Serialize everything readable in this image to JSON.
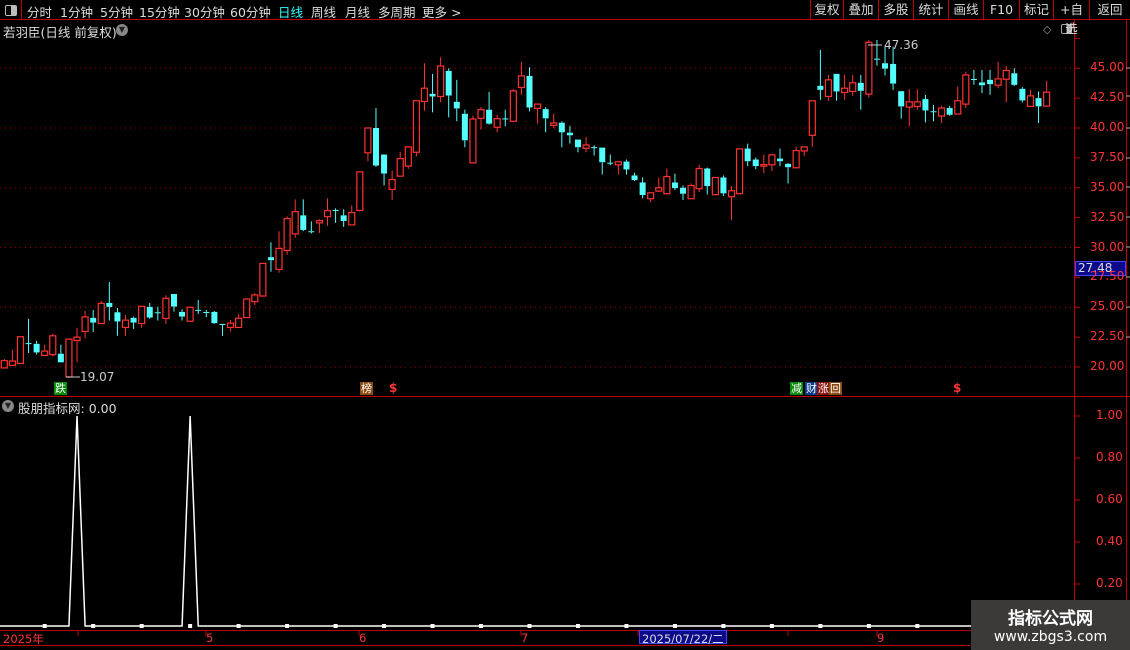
{
  "toolbar": {
    "periods": [
      "分时",
      "1分钟",
      "5分钟",
      "15分钟",
      "30分钟",
      "60分钟",
      "日线",
      "周线",
      "月线",
      "多周期",
      "更多 >"
    ],
    "active": "日线",
    "right_buttons": [
      "复权",
      "叠加",
      "多股",
      "统计",
      "画线",
      "F10",
      "标记",
      "+自选",
      "返回"
    ]
  },
  "chart_title": "若羽臣(日线 前复权)",
  "price_axis": {
    "labels": [
      "45.00",
      "42.50",
      "40.00",
      "37.50",
      "35.00",
      "32.50",
      "30.00",
      "27.50",
      "25.00",
      "22.50",
      "20.00"
    ],
    "current_price": "27.48"
  },
  "annotations": {
    "low": "19.07",
    "high": "47.36"
  },
  "signals": [
    {
      "text": "跌",
      "color": "#0a8a0a"
    },
    {
      "text": "榜",
      "color": "#8a4a10"
    },
    {
      "text": "$",
      "color": "#ff3333"
    },
    {
      "text": "减",
      "color": "#0a8a0a"
    },
    {
      "text": "财",
      "color": "#0a3a8a"
    },
    {
      "text": "涨",
      "color": "#8a1010"
    },
    {
      "text": "回",
      "color": "#8a4a10"
    },
    {
      "text": "$",
      "color": "#ff3333"
    }
  ],
  "indicator": {
    "title": "股朋指标网",
    "value": ": 0.00",
    "axis_labels": [
      "1.00",
      "0.80",
      "0.60",
      "0.40",
      "0.20"
    ]
  },
  "time_axis": {
    "labels": [
      "2025年",
      "5",
      "6",
      "7",
      "9"
    ],
    "cursor_date": "2025/07/22/二"
  },
  "watermark": {
    "name": "指标公式网",
    "url": "www.zbgs3.com"
  },
  "colors": {
    "up": "#ff3232",
    "down": "#54ffff",
    "axis": "#c00000",
    "grid": "#a00000"
  },
  "chart_data": {
    "type": "candlestick",
    "ylim": [
      18,
      48
    ],
    "ohlc": [
      [
        19.92,
        20.67,
        19.92,
        20.53
      ],
      [
        20.14,
        21.45,
        20.14,
        20.5
      ],
      [
        20.3,
        22.53,
        20.3,
        22.53
      ],
      [
        22.0,
        24.03,
        21.17,
        21.98
      ],
      [
        21.94,
        22.19,
        21.06,
        21.22
      ],
      [
        20.97,
        21.86,
        20.97,
        21.33
      ],
      [
        21.03,
        22.78,
        20.89,
        22.61
      ],
      [
        21.11,
        21.86,
        20.39,
        20.39
      ],
      [
        19.17,
        22.33,
        19.07,
        22.33
      ],
      [
        22.22,
        23.28,
        20.39,
        22.5
      ],
      [
        22.97,
        24.69,
        22.39,
        24.19
      ],
      [
        24.11,
        24.78,
        22.94,
        23.72
      ],
      [
        23.64,
        25.53,
        23.64,
        25.33
      ],
      [
        25.36,
        27.11,
        23.89,
        25.03
      ],
      [
        24.58,
        24.94,
        22.61,
        23.81
      ],
      [
        23.31,
        24.36,
        22.61,
        23.92
      ],
      [
        24.11,
        24.22,
        23.19,
        23.72
      ],
      [
        23.64,
        25.11,
        23.28,
        25.08
      ],
      [
        25.03,
        25.36,
        24.03,
        24.14
      ],
      [
        24.58,
        25.06,
        23.89,
        24.53
      ],
      [
        24.06,
        26.0,
        23.61,
        25.75
      ],
      [
        26.11,
        26.11,
        24.64,
        25.06
      ],
      [
        24.61,
        24.83,
        23.89,
        24.22
      ],
      [
        23.83,
        25.06,
        23.83,
        25.0
      ],
      [
        24.78,
        25.61,
        24.44,
        24.72
      ],
      [
        24.6,
        24.78,
        24.17,
        24.53
      ],
      [
        24.61,
        24.69,
        23.61,
        23.67
      ],
      [
        23.6,
        23.6,
        22.61,
        23.58
      ],
      [
        23.31,
        23.94,
        22.97,
        23.67
      ],
      [
        23.31,
        24.44,
        23.31,
        24.08
      ],
      [
        24.14,
        25.75,
        24.14,
        25.69
      ],
      [
        25.47,
        26.17,
        25.19,
        26.03
      ],
      [
        25.94,
        28.67,
        25.89,
        28.67
      ],
      [
        29.19,
        30.44,
        27.97,
        28.94
      ],
      [
        28.17,
        31.36,
        27.89,
        29.92
      ],
      [
        29.75,
        32.61,
        29.39,
        32.42
      ],
      [
        31.14,
        34.03,
        30.81,
        33.0
      ],
      [
        32.69,
        34.03,
        31.36,
        31.47
      ],
      [
        31.36,
        32.19,
        31.17,
        31.33
      ],
      [
        32.06,
        32.36,
        31.22,
        32.25
      ],
      [
        32.58,
        34.11,
        31.81,
        33.08
      ],
      [
        33.14,
        33.28,
        32.06,
        33.08
      ],
      [
        32.69,
        33.19,
        31.72,
        32.22
      ],
      [
        31.89,
        33.53,
        31.89,
        32.92
      ],
      [
        33.1,
        36.33,
        33.0,
        36.33
      ],
      [
        37.92,
        40.0,
        37.22,
        40.0
      ],
      [
        40.0,
        41.67,
        36.75,
        36.86
      ],
      [
        37.78,
        37.78,
        35.19,
        36.19
      ],
      [
        34.86,
        36.44,
        33.97,
        35.69
      ],
      [
        35.97,
        38.0,
        35.97,
        37.44
      ],
      [
        36.81,
        38.42,
        36.58,
        38.42
      ],
      [
        37.97,
        42.28,
        37.64,
        42.28
      ],
      [
        42.22,
        45.42,
        41.44,
        43.33
      ],
      [
        42.86,
        44.53,
        41.31,
        42.64
      ],
      [
        42.64,
        45.92,
        42.14,
        45.19
      ],
      [
        44.78,
        45.0,
        40.89,
        42.72
      ],
      [
        42.19,
        44.03,
        40.56,
        41.64
      ],
      [
        41.19,
        41.53,
        38.39,
        38.97
      ],
      [
        37.08,
        41.03,
        37.08,
        40.75
      ],
      [
        40.81,
        41.75,
        39.86,
        41.53
      ],
      [
        41.53,
        43.03,
        40.28,
        40.36
      ],
      [
        40.06,
        41.11,
        39.64,
        40.78
      ],
      [
        40.8,
        41.53,
        40.14,
        40.75
      ],
      [
        40.56,
        43.25,
        40.56,
        43.11
      ],
      [
        43.39,
        45.53,
        42.78,
        44.36
      ],
      [
        44.36,
        45.08,
        41.39,
        41.72
      ],
      [
        41.64,
        42.0,
        40.36,
        42.0
      ],
      [
        41.58,
        41.75,
        39.64,
        40.81
      ],
      [
        40.22,
        41.19,
        39.97,
        40.42
      ],
      [
        40.44,
        40.56,
        38.39,
        39.64
      ],
      [
        39.61,
        40.19,
        38.69,
        39.39
      ],
      [
        39.03,
        39.03,
        37.97,
        38.39
      ],
      [
        38.31,
        39.25,
        37.97,
        38.58
      ],
      [
        38.4,
        38.56,
        37.69,
        38.36
      ],
      [
        38.36,
        38.36,
        36.11,
        37.14
      ],
      [
        37.1,
        37.78,
        36.89,
        37.06
      ],
      [
        36.92,
        37.17,
        36.11,
        37.17
      ],
      [
        37.19,
        37.36,
        36.11,
        36.53
      ],
      [
        36.03,
        36.25,
        35.56,
        35.64
      ],
      [
        35.44,
        35.86,
        34.11,
        34.39
      ],
      [
        34.08,
        34.58,
        33.81,
        34.58
      ],
      [
        34.72,
        35.86,
        34.64,
        35.0
      ],
      [
        34.5,
        36.61,
        34.5,
        35.94
      ],
      [
        35.44,
        36.19,
        34.81,
        34.97
      ],
      [
        35.0,
        35.19,
        33.97,
        34.5
      ],
      [
        34.08,
        35.36,
        34.08,
        35.19
      ],
      [
        34.92,
        36.92,
        34.64,
        36.61
      ],
      [
        36.61,
        36.69,
        34.44,
        35.14
      ],
      [
        34.42,
        35.86,
        34.42,
        35.86
      ],
      [
        35.86,
        36.03,
        34.31,
        34.53
      ],
      [
        34.25,
        35.14,
        32.31,
        34.75
      ],
      [
        34.5,
        38.25,
        34.5,
        38.25
      ],
      [
        38.28,
        38.69,
        36.81,
        37.22
      ],
      [
        37.36,
        37.53,
        36.56,
        36.81
      ],
      [
        36.81,
        37.78,
        36.22,
        36.94
      ],
      [
        36.92,
        37.75,
        36.39,
        37.75
      ],
      [
        37.44,
        38.28,
        36.81,
        37.22
      ],
      [
        37.0,
        37.08,
        35.36,
        36.72
      ],
      [
        36.67,
        38.44,
        36.67,
        38.11
      ],
      [
        38.08,
        38.42,
        37.64,
        38.42
      ],
      [
        39.39,
        42.28,
        38.42,
        42.28
      ],
      [
        43.53,
        46.53,
        42.36,
        43.19
      ],
      [
        42.64,
        44.44,
        42.28,
        44.03
      ],
      [
        44.53,
        44.53,
        42.28,
        43.06
      ],
      [
        42.97,
        44.44,
        42.36,
        43.33
      ],
      [
        43.06,
        44.44,
        42.69,
        43.78
      ],
      [
        43.78,
        44.44,
        41.53,
        43.11
      ],
      [
        42.83,
        47.36,
        42.56,
        47.17
      ],
      [
        45.8,
        47.36,
        45.22,
        45.72
      ],
      [
        45.42,
        46.8,
        44.39,
        44.97
      ],
      [
        45.36,
        46.8,
        43.19,
        43.72
      ],
      [
        43.08,
        43.08,
        40.78,
        41.81
      ],
      [
        41.75,
        43.25,
        40.14,
        42.19
      ],
      [
        41.8,
        43.25,
        41.53,
        42.19
      ],
      [
        42.42,
        42.78,
        40.47,
        41.47
      ],
      [
        41.4,
        41.94,
        40.56,
        41.36
      ],
      [
        41.0,
        41.86,
        40.42,
        41.67
      ],
      [
        41.67,
        41.86,
        41.03,
        41.11
      ],
      [
        41.17,
        43.47,
        41.17,
        42.28
      ],
      [
        42.0,
        44.72,
        41.67,
        44.44
      ],
      [
        44.1,
        44.86,
        43.61,
        44.06
      ],
      [
        43.81,
        44.86,
        42.92,
        43.58
      ],
      [
        44.03,
        44.86,
        42.78,
        43.67
      ],
      [
        43.58,
        45.53,
        43.33,
        44.11
      ],
      [
        44.08,
        45.19,
        42.14,
        44.81
      ],
      [
        44.58,
        45.0,
        43.53,
        43.61
      ],
      [
        43.28,
        43.42,
        42.14,
        42.31
      ],
      [
        41.81,
        43.19,
        41.81,
        42.69
      ],
      [
        42.5,
        43.06,
        40.42,
        41.81
      ],
      [
        41.83,
        43.94,
        41.83,
        43.0
      ]
    ],
    "indicator_ylim": [
      0,
      1
    ],
    "indicator_spikes": [
      9,
      23
    ]
  }
}
